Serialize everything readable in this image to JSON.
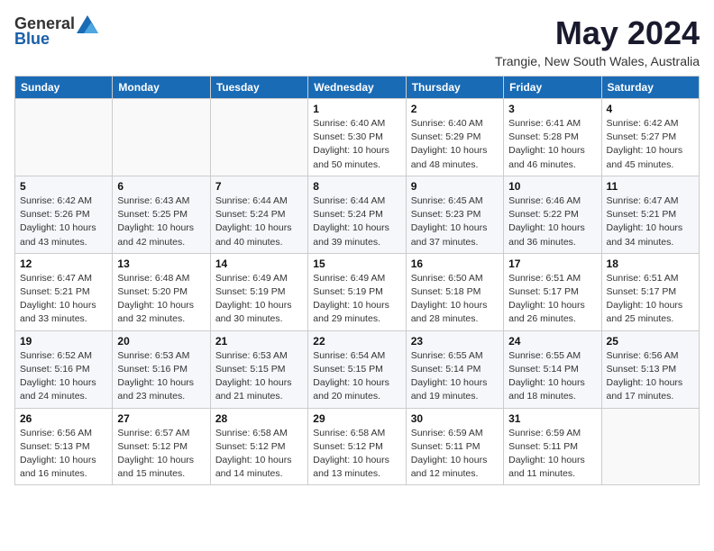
{
  "logo": {
    "general": "General",
    "blue": "Blue"
  },
  "title": "May 2024",
  "subtitle": "Trangie, New South Wales, Australia",
  "weekdays": [
    "Sunday",
    "Monday",
    "Tuesday",
    "Wednesday",
    "Thursday",
    "Friday",
    "Saturday"
  ],
  "weeks": [
    [
      {
        "day": "",
        "info": ""
      },
      {
        "day": "",
        "info": ""
      },
      {
        "day": "",
        "info": ""
      },
      {
        "day": "1",
        "info": "Sunrise: 6:40 AM\nSunset: 5:30 PM\nDaylight: 10 hours\nand 50 minutes."
      },
      {
        "day": "2",
        "info": "Sunrise: 6:40 AM\nSunset: 5:29 PM\nDaylight: 10 hours\nand 48 minutes."
      },
      {
        "day": "3",
        "info": "Sunrise: 6:41 AM\nSunset: 5:28 PM\nDaylight: 10 hours\nand 46 minutes."
      },
      {
        "day": "4",
        "info": "Sunrise: 6:42 AM\nSunset: 5:27 PM\nDaylight: 10 hours\nand 45 minutes."
      }
    ],
    [
      {
        "day": "5",
        "info": "Sunrise: 6:42 AM\nSunset: 5:26 PM\nDaylight: 10 hours\nand 43 minutes."
      },
      {
        "day": "6",
        "info": "Sunrise: 6:43 AM\nSunset: 5:25 PM\nDaylight: 10 hours\nand 42 minutes."
      },
      {
        "day": "7",
        "info": "Sunrise: 6:44 AM\nSunset: 5:24 PM\nDaylight: 10 hours\nand 40 minutes."
      },
      {
        "day": "8",
        "info": "Sunrise: 6:44 AM\nSunset: 5:24 PM\nDaylight: 10 hours\nand 39 minutes."
      },
      {
        "day": "9",
        "info": "Sunrise: 6:45 AM\nSunset: 5:23 PM\nDaylight: 10 hours\nand 37 minutes."
      },
      {
        "day": "10",
        "info": "Sunrise: 6:46 AM\nSunset: 5:22 PM\nDaylight: 10 hours\nand 36 minutes."
      },
      {
        "day": "11",
        "info": "Sunrise: 6:47 AM\nSunset: 5:21 PM\nDaylight: 10 hours\nand 34 minutes."
      }
    ],
    [
      {
        "day": "12",
        "info": "Sunrise: 6:47 AM\nSunset: 5:21 PM\nDaylight: 10 hours\nand 33 minutes."
      },
      {
        "day": "13",
        "info": "Sunrise: 6:48 AM\nSunset: 5:20 PM\nDaylight: 10 hours\nand 32 minutes."
      },
      {
        "day": "14",
        "info": "Sunrise: 6:49 AM\nSunset: 5:19 PM\nDaylight: 10 hours\nand 30 minutes."
      },
      {
        "day": "15",
        "info": "Sunrise: 6:49 AM\nSunset: 5:19 PM\nDaylight: 10 hours\nand 29 minutes."
      },
      {
        "day": "16",
        "info": "Sunrise: 6:50 AM\nSunset: 5:18 PM\nDaylight: 10 hours\nand 28 minutes."
      },
      {
        "day": "17",
        "info": "Sunrise: 6:51 AM\nSunset: 5:17 PM\nDaylight: 10 hours\nand 26 minutes."
      },
      {
        "day": "18",
        "info": "Sunrise: 6:51 AM\nSunset: 5:17 PM\nDaylight: 10 hours\nand 25 minutes."
      }
    ],
    [
      {
        "day": "19",
        "info": "Sunrise: 6:52 AM\nSunset: 5:16 PM\nDaylight: 10 hours\nand 24 minutes."
      },
      {
        "day": "20",
        "info": "Sunrise: 6:53 AM\nSunset: 5:16 PM\nDaylight: 10 hours\nand 23 minutes."
      },
      {
        "day": "21",
        "info": "Sunrise: 6:53 AM\nSunset: 5:15 PM\nDaylight: 10 hours\nand 21 minutes."
      },
      {
        "day": "22",
        "info": "Sunrise: 6:54 AM\nSunset: 5:15 PM\nDaylight: 10 hours\nand 20 minutes."
      },
      {
        "day": "23",
        "info": "Sunrise: 6:55 AM\nSunset: 5:14 PM\nDaylight: 10 hours\nand 19 minutes."
      },
      {
        "day": "24",
        "info": "Sunrise: 6:55 AM\nSunset: 5:14 PM\nDaylight: 10 hours\nand 18 minutes."
      },
      {
        "day": "25",
        "info": "Sunrise: 6:56 AM\nSunset: 5:13 PM\nDaylight: 10 hours\nand 17 minutes."
      }
    ],
    [
      {
        "day": "26",
        "info": "Sunrise: 6:56 AM\nSunset: 5:13 PM\nDaylight: 10 hours\nand 16 minutes."
      },
      {
        "day": "27",
        "info": "Sunrise: 6:57 AM\nSunset: 5:12 PM\nDaylight: 10 hours\nand 15 minutes."
      },
      {
        "day": "28",
        "info": "Sunrise: 6:58 AM\nSunset: 5:12 PM\nDaylight: 10 hours\nand 14 minutes."
      },
      {
        "day": "29",
        "info": "Sunrise: 6:58 AM\nSunset: 5:12 PM\nDaylight: 10 hours\nand 13 minutes."
      },
      {
        "day": "30",
        "info": "Sunrise: 6:59 AM\nSunset: 5:11 PM\nDaylight: 10 hours\nand 12 minutes."
      },
      {
        "day": "31",
        "info": "Sunrise: 6:59 AM\nSunset: 5:11 PM\nDaylight: 10 hours\nand 11 minutes."
      },
      {
        "day": "",
        "info": ""
      }
    ]
  ]
}
